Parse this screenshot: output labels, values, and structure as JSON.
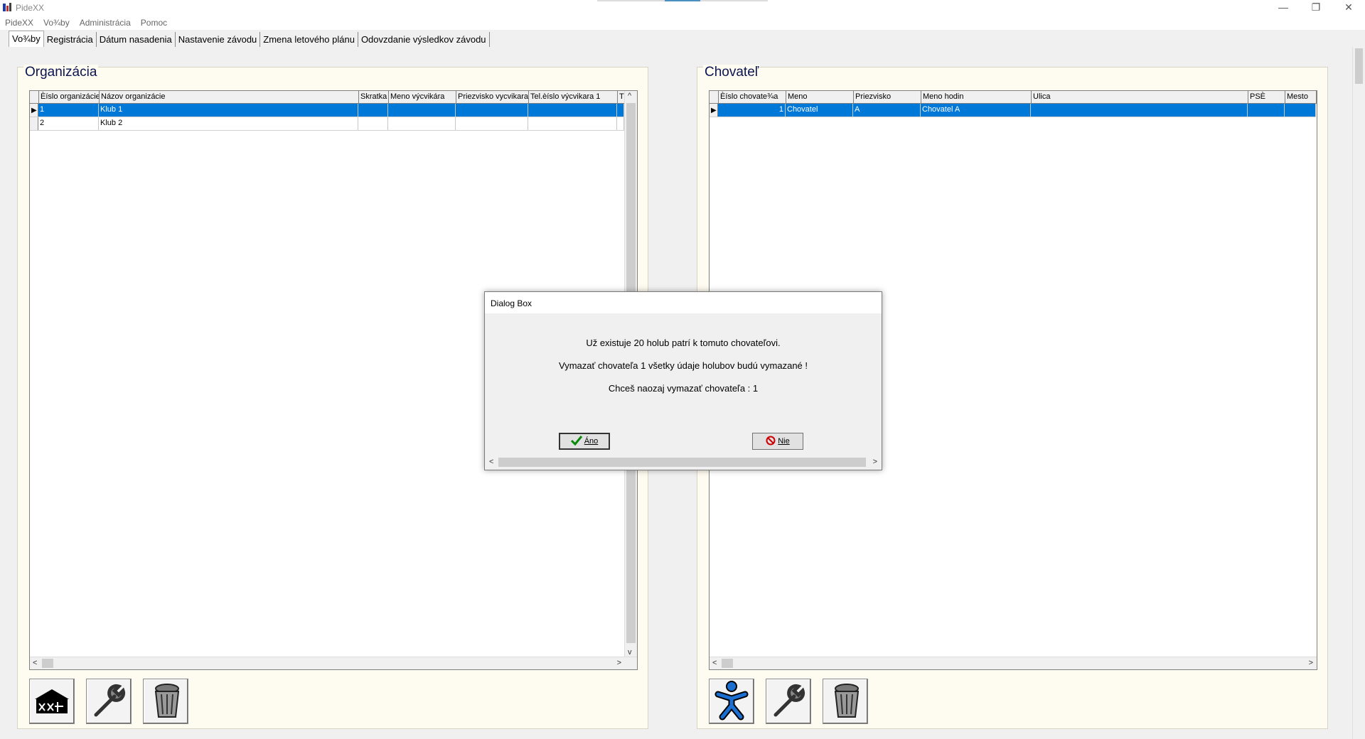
{
  "window": {
    "title": "PideXX",
    "minimize": "—",
    "restore": "❐",
    "close": "✕"
  },
  "menu": [
    "PideXX",
    "Vo¾by",
    "Administrácia",
    "Pomoc"
  ],
  "tabs": [
    "Vo¾by",
    "Registrácia",
    "Dátum nasadenia",
    "Nastavenie závodu",
    "Zmena letového plánu",
    "Odovzdanie výsledkov závodu"
  ],
  "left_panel": {
    "title": "Organizácia",
    "columns": [
      "Èíslo organizácie",
      "Názov organizácie",
      "Skratka",
      "Meno výcvikára",
      "Priezvisko vycvikara",
      "Tel.èíslo výcvikara 1",
      "T"
    ],
    "rows": [
      [
        "1",
        "Klub 1",
        "",
        "",
        "",
        "",
        ""
      ],
      [
        "2",
        "Klub 2",
        "",
        "",
        "",
        "",
        ""
      ]
    ],
    "buttons": [
      "organization-icon",
      "wrench-icon",
      "trash-icon"
    ]
  },
  "right_panel": {
    "title": "Chovateľ",
    "columns": [
      "Èíslo chovate¾a",
      "Meno",
      "Priezvisko",
      "Meno hodin",
      "Ulica",
      "PSÈ",
      "Mesto"
    ],
    "rows": [
      [
        "1",
        "Chovatel",
        "A",
        "Chovatel A",
        "",
        "",
        ""
      ]
    ],
    "buttons": [
      "person-icon",
      "wrench-icon",
      "trash-icon"
    ]
  },
  "dialog": {
    "title": "Dialog Box",
    "line1": "Už existuje 20  holub patrí k tomuto chovateľovi.",
    "line2": "Vymazať chovateľa 1  všetky údaje holubov budú vymazané !",
    "line3": "Chceš naozaj vymazať chovateľa : 1",
    "yes_label": "Áno",
    "no_label": "Nie",
    "colors": {
      "check": "#0a8a0a",
      "no": "#cc0000"
    }
  },
  "colors": {
    "selection": "#0078d7",
    "panel_title": "#0a1450",
    "panel_bg": "#fefbf0"
  },
  "scroll_arrows": {
    "left": "<",
    "right": ">",
    "up": "^",
    "down": "v"
  }
}
